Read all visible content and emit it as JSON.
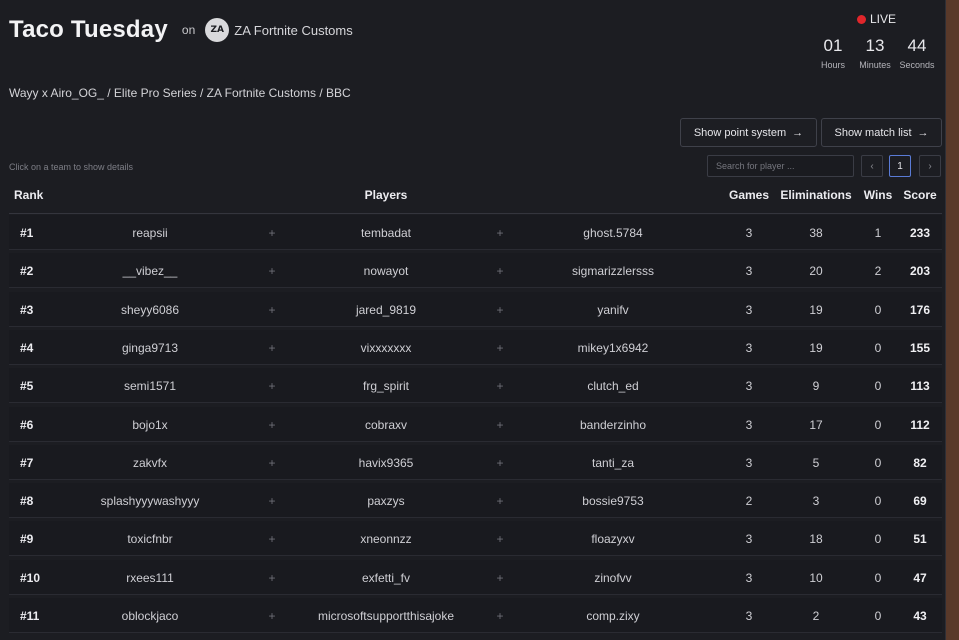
{
  "header": {
    "title": "Taco Tuesday",
    "on_label": "on",
    "org_logo_text": "ZA",
    "org_name": "ZA Fortnite Customs",
    "live_label": "LIVE",
    "countdown": [
      {
        "value": "01",
        "label": "Hours"
      },
      {
        "value": "13",
        "label": "Minutes"
      },
      {
        "value": "44",
        "label": "Seconds"
      }
    ],
    "breadcrumb": "Wayy x Airo_OG_ / Elite Pro Series / ZA Fortnite Customs / BBC"
  },
  "toolbar": {
    "points_label": "Show point system",
    "matches_label": "Show match list",
    "arrow": "→",
    "hint": "Click on a team to show details",
    "search_placeholder": "Search for player ...",
    "search_value": "",
    "prev": "‹",
    "page": "1",
    "next": "›"
  },
  "table": {
    "headers": {
      "rank": "Rank",
      "players": "Players",
      "games": "Games",
      "eliminations": "Eliminations",
      "wins": "Wins",
      "score": "Score"
    },
    "separator": "+",
    "rows": [
      {
        "rank": "#1",
        "p1": "reapsii",
        "p2": "tembadat",
        "p3": "ghost.5784",
        "games": "3",
        "elims": "38",
        "wins": "1",
        "score": "233"
      },
      {
        "rank": "#2",
        "p1": "__vibez__",
        "p2": "nowayot",
        "p3": "sigmarizzlersss",
        "games": "3",
        "elims": "20",
        "wins": "2",
        "score": "203"
      },
      {
        "rank": "#3",
        "p1": "sheyy6086",
        "p2": "jared_9819",
        "p3": "yanifv",
        "games": "3",
        "elims": "19",
        "wins": "0",
        "score": "176"
      },
      {
        "rank": "#4",
        "p1": "ginga9713",
        "p2": "vixxxxxxx",
        "p3": "mikey1x6942",
        "games": "3",
        "elims": "19",
        "wins": "0",
        "score": "155"
      },
      {
        "rank": "#5",
        "p1": "semi1571",
        "p2": "frg_spirit",
        "p3": "clutch_ed",
        "games": "3",
        "elims": "9",
        "wins": "0",
        "score": "113"
      },
      {
        "rank": "#6",
        "p1": "bojo1x",
        "p2": "cobraxv",
        "p3": "banderzinho",
        "games": "3",
        "elims": "17",
        "wins": "0",
        "score": "112"
      },
      {
        "rank": "#7",
        "p1": "zakvfx",
        "p2": "havix9365",
        "p3": "tanti_za",
        "games": "3",
        "elims": "5",
        "wins": "0",
        "score": "82"
      },
      {
        "rank": "#8",
        "p1": "splashyyywashyyy",
        "p2": "paxzys",
        "p3": "bossie9753",
        "games": "2",
        "elims": "3",
        "wins": "0",
        "score": "69"
      },
      {
        "rank": "#9",
        "p1": "toxicfnbr",
        "p2": "xneonnzz",
        "p3": "floazyxv",
        "games": "3",
        "elims": "18",
        "wins": "0",
        "score": "51"
      },
      {
        "rank": "#10",
        "p1": "rxees111",
        "p2": "exfetti_fv",
        "p3": "zinofvv",
        "games": "3",
        "elims": "10",
        "wins": "0",
        "score": "47"
      },
      {
        "rank": "#11",
        "p1": "oblockjaco",
        "p2": "microsoftsupportthisajoke",
        "p3": "comp.zixy",
        "games": "3",
        "elims": "2",
        "wins": "0",
        "score": "43"
      }
    ]
  }
}
